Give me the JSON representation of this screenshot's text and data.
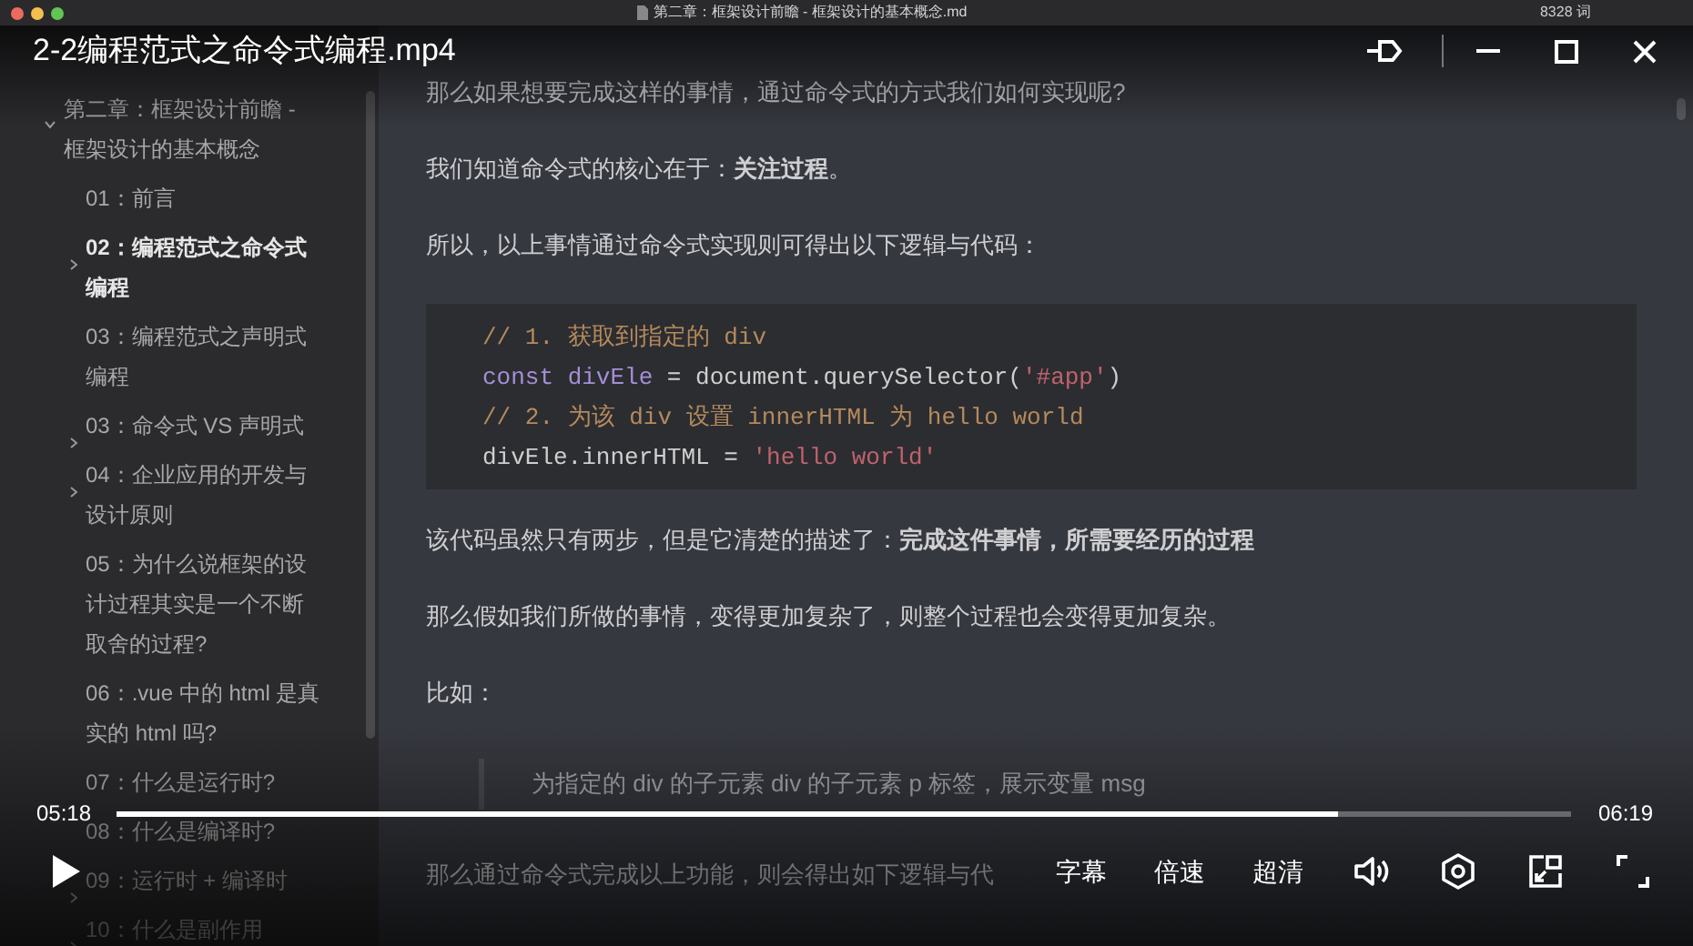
{
  "recording": {
    "window_title": "第二章：框架设计前瞻 - 框架设计的基本概念.md",
    "word_count": "8328 词",
    "outline": [
      {
        "label": "第二章：框架设计前瞻 - 框架设计的基本概念",
        "kind": "folder",
        "expanded": true,
        "selected": false,
        "children": [
          {
            "label": "01：前言",
            "kind": "page",
            "selected": false
          },
          {
            "label": "02：编程范式之命令式编程",
            "kind": "folder",
            "expanded": false,
            "selected": true
          },
          {
            "label": "03：编程范式之声明式编程",
            "kind": "page",
            "selected": false
          },
          {
            "label": "03：命令式 VS 声明式",
            "kind": "folder",
            "expanded": false,
            "selected": false
          },
          {
            "label": "04：企业应用的开发与设计原则",
            "kind": "folder",
            "expanded": false,
            "selected": false
          },
          {
            "label": "05：为什么说框架的设计过程其实是一个不断取舍的过程?",
            "kind": "page",
            "selected": false
          },
          {
            "label": "06：.vue 中的 html 是真实的 html 吗?",
            "kind": "page",
            "selected": false
          },
          {
            "label": "07：什么是运行时?",
            "kind": "page",
            "selected": false
          },
          {
            "label": "08：什么是编译时?",
            "kind": "page",
            "selected": false
          },
          {
            "label": "09：运行时 + 编译时",
            "kind": "folder",
            "expanded": false,
            "selected": false
          },
          {
            "label": "10：什么是副作用",
            "kind": "folder",
            "expanded": false,
            "selected": false
          }
        ]
      }
    ],
    "blocks": [
      {
        "kind": "paragraph",
        "text": "那么如果想要完成这样的事情，通过命令式的方式我们如何实现呢?"
      },
      {
        "kind": "paragraph",
        "text": "我们知道命令式的核心在于：**关注过程**。"
      },
      {
        "kind": "paragraph",
        "text": "所以，以上事情通过命令式实现则可得出以下逻辑与代码："
      },
      {
        "kind": "code",
        "lines": [
          [
            {
              "kind": "comment",
              "text": "// 1. 获取到指定的 div"
            }
          ],
          [
            {
              "kind": "keyword",
              "text": "const "
            },
            {
              "kind": "variable",
              "text": "divEle"
            },
            {
              "kind": "plain",
              "text": " = document.querySelector("
            },
            {
              "kind": "string",
              "text": "'#app'"
            },
            {
              "kind": "plain",
              "text": ")"
            }
          ],
          [
            {
              "kind": "comment",
              "text": "// 2. 为该 div 设置 innerHTML 为 hello world"
            }
          ],
          [
            {
              "kind": "plain",
              "text": "divEle.innerHTML = "
            },
            {
              "kind": "string",
              "text": "'hello world'"
            }
          ]
        ]
      },
      {
        "kind": "paragraph",
        "text": "该代码虽然只有两步，但是它清楚的描述了：**完成这件事情，所需要经历的过程**"
      },
      {
        "kind": "paragraph",
        "text": "那么假如我们所做的事情，变得更加复杂了，则整个过程也会变得更加复杂。"
      },
      {
        "kind": "paragraph",
        "text": "比如："
      },
      {
        "kind": "quote",
        "text": "为指定的 div 的子元素 div 的子元素 p 标签，展示变量 msg"
      },
      {
        "kind": "paragraph",
        "text": "那么通过命令式完成以上功能，则会得出如下逻辑与代"
      }
    ]
  },
  "player": {
    "title": "2-2编程范式之命令式编程.mp4",
    "elapsed": "05:18",
    "duration": "06:19",
    "level": 0.84,
    "playing": false,
    "buttons": [
      {
        "kind": "text",
        "label": "字幕"
      },
      {
        "kind": "text",
        "label": "倍速"
      },
      {
        "kind": "text",
        "label": "超清"
      },
      {
        "kind": "volume"
      },
      {
        "kind": "settings"
      },
      {
        "kind": "pip"
      },
      {
        "kind": "fullscreen"
      }
    ]
  }
}
